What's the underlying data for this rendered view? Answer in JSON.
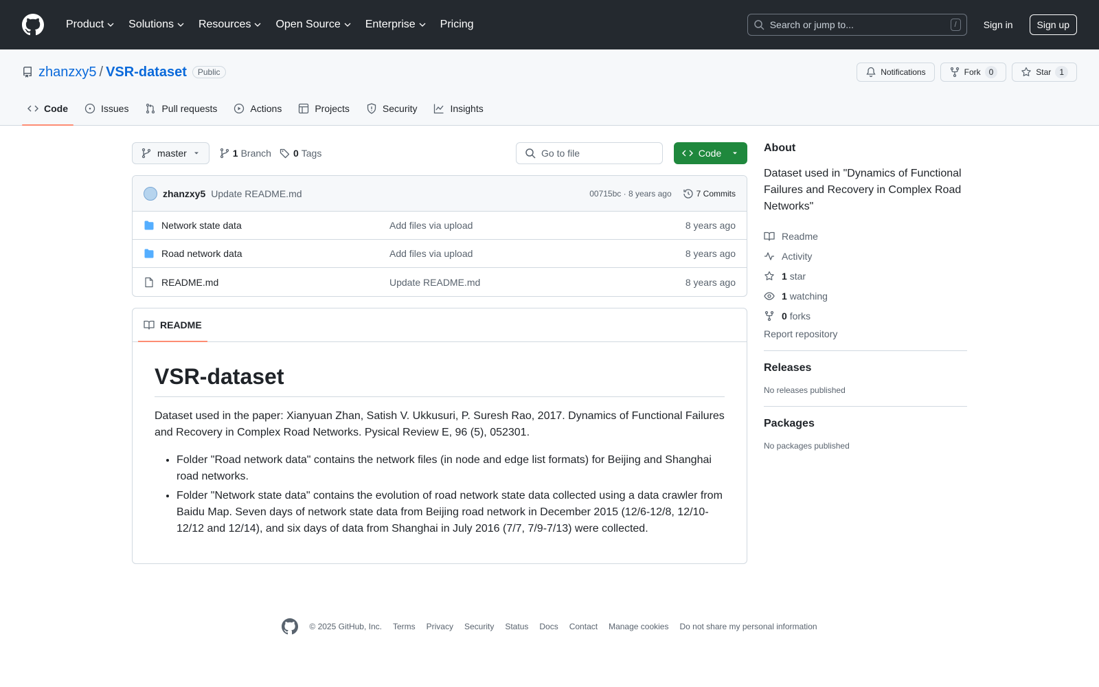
{
  "header": {
    "nav": [
      "Product",
      "Solutions",
      "Resources",
      "Open Source",
      "Enterprise",
      "Pricing"
    ],
    "search_placeholder": "Search or jump to...",
    "search_shortcut": "/",
    "sign_in": "Sign in",
    "sign_up": "Sign up"
  },
  "repo": {
    "owner": "zhanzxy5",
    "separator": "/",
    "name": "VSR-dataset",
    "visibility": "Public",
    "notifications": "Notifications",
    "fork_label": "Fork",
    "fork_count": "0",
    "star_label": "Star",
    "star_count": "1",
    "tabs": [
      "Code",
      "Issues",
      "Pull requests",
      "Actions",
      "Projects",
      "Security",
      "Insights"
    ]
  },
  "file_nav": {
    "branch": "master",
    "branch_count": "1",
    "branch_label": "Branch",
    "tag_count": "0",
    "tag_label": "Tags",
    "go_to_file": "Go to file",
    "code_button": "Code"
  },
  "commit": {
    "author": "zhanzxy5",
    "message": "Update README.md",
    "meta": "00715bc · 8 years ago",
    "commits_label": "7 Commits"
  },
  "files": [
    {
      "name": "Network state data",
      "type": "folder",
      "commit": "Add files via upload",
      "age": "8 years ago"
    },
    {
      "name": "Road network data",
      "type": "folder",
      "commit": "Add files via upload",
      "age": "8 years ago"
    },
    {
      "name": "README.md",
      "type": "file",
      "commit": "Update README.md",
      "age": "8 years ago"
    }
  ],
  "readme": {
    "tab": "README",
    "title": "VSR-dataset",
    "intro": "Dataset used in the paper: Xianyuan Zhan, Satish V. Ukkusuri, P. Suresh Rao, 2017. Dynamics of Functional Failures and Recovery in Complex Road Networks. Pysical Review E, 96 (5), 052301.",
    "bullets": [
      "Folder \"Road network data\" contains the network files (in node and edge list formats) for Beijing and Shanghai road networks.",
      "Folder \"Network state data\" contains the evolution of road network state data collected using a data crawler from Baidu Map. Seven days of network state data from Beijing road network in December 2015 (12/6-12/8, 12/10-12/12 and 12/14), and six days of data from Shanghai in July 2016 (7/7, 7/9-7/13) were collected."
    ]
  },
  "about": {
    "heading": "About",
    "description": "Dataset used in \"Dynamics of Functional Failures and Recovery in Complex Road Networks\"",
    "readme": "Readme",
    "activity": "Activity",
    "stars_count": "1",
    "stars_label": "star",
    "watching_count": "1",
    "watching_label": "watching",
    "forks_count": "0",
    "forks_label": "forks",
    "report": "Report repository"
  },
  "releases": {
    "heading": "Releases",
    "empty": "No releases published"
  },
  "packages": {
    "heading": "Packages",
    "empty": "No packages published"
  },
  "footer": {
    "copyright": "© 2025 GitHub, Inc.",
    "links": [
      "Terms",
      "Privacy",
      "Security",
      "Status",
      "Docs",
      "Contact",
      "Manage cookies",
      "Do not share my personal information"
    ]
  },
  "colors": {
    "header_bg": "#24292f",
    "accent": "#0969da",
    "code_button": "#1f883d",
    "tab_underline": "#fd8c73",
    "folder": "#54aeff"
  }
}
